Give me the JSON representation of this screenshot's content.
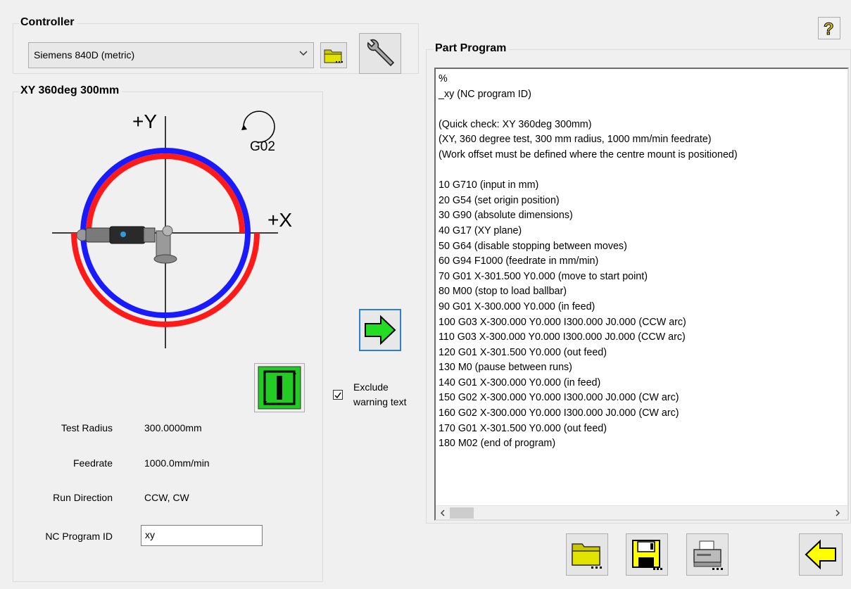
{
  "controller": {
    "title": "Controller",
    "selected": "Siemens 840D (metric)",
    "open_icon": "folder-open-icon",
    "settings_icon": "wrench-icon"
  },
  "test": {
    "title": "XY 360deg 300mm",
    "axis_y": "+Y",
    "axis_x": "+X",
    "gcode_badge": "G02",
    "fields": [
      {
        "label": "Test Radius",
        "value": "300.0000mm"
      },
      {
        "label": "Feedrate",
        "value": "1000.0mm/min"
      },
      {
        "label": "Run Direction",
        "value": "CCW, CW"
      }
    ],
    "program_id_label": "NC Program ID",
    "program_id_value": "xy"
  },
  "exclude_warning": {
    "label_line1": "Exclude",
    "label_line2": "warning text",
    "checked": true
  },
  "part_program": {
    "title": "Part Program",
    "text": "%\n_xy (NC program ID)\n\n(Quick check: XY 360deg 300mm)\n(XY, 360 degree test, 300 mm radius, 1000 mm/min feedrate)\n(Work offset must be defined where the centre mount is positioned)\n\n10 G710 (input in mm)\n20 G54 (set origin position)\n30 G90 (absolute dimensions)\n40 G17 (XY plane)\n50 G64 (disable stopping between moves)\n60 G94 F1000 (feedrate in mm/min)\n70 G01 X-301.500 Y0.000 (move to start point)\n80 M00 (stop to load ballbar)\n90 G01 X-300.000 Y0.000 (in feed)\n100 G03 X-300.000 Y0.000 I300.000 J0.000 (CCW arc)\n110 G03 X-300.000 Y0.000 I300.000 J0.000 (CCW arc)\n120 G01 X-301.500 Y0.000 (out feed)\n130 M0 (pause between runs)\n140 G01 X-300.000 Y0.000 (in feed)\n150 G02 X-300.000 Y0.000 I300.000 J0.000 (CW arc)\n160 G02 X-300.000 Y0.000 I300.000 J0.000 (CW arc)\n170 G01 X-301.500 Y0.000 (out feed)\n180 M02 (end of program)"
  },
  "colors": {
    "circle_outer": "#1a1aff",
    "circle_inner": "#ff1a1a",
    "green": "#22cc22",
    "arrow_yellow": "#ffff00",
    "folder_olive": "#c8c800"
  },
  "icons": {
    "help": "help-icon",
    "transfer": "arrow-right-icon",
    "back": "arrow-left-icon",
    "open_file": "folder-open-icon",
    "save": "save-icon",
    "print": "print-icon",
    "start": "start-test-icon"
  }
}
